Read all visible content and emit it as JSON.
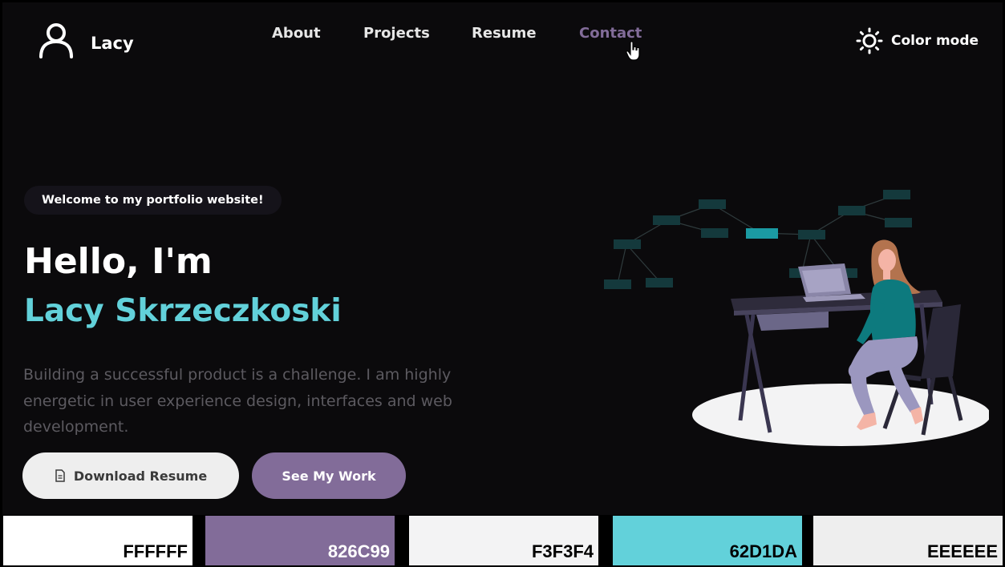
{
  "header": {
    "brand_name": "Lacy",
    "nav": {
      "about": "About",
      "projects": "Projects",
      "resume": "Resume",
      "contact": "Contact"
    },
    "color_mode_label": "Color mode"
  },
  "hero": {
    "badge": "Welcome to my portfolio website!",
    "greeting": "Hello, I'm",
    "name": "Lacy Skrzeczkoski",
    "description": "Building a successful product is a challenge. I am highly energetic in user experience design, interfaces and web development.",
    "download_button": "Download Resume",
    "work_button": "See My Work"
  },
  "palette": [
    {
      "label": "FFFFFF",
      "color": "#FFFFFF",
      "text_color": "#000000"
    },
    {
      "label": "826C99",
      "color": "#826C99",
      "text_color": "#FFFFFF"
    },
    {
      "label": "F3F3F4",
      "color": "#F3F3F4",
      "text_color": "#000000"
    },
    {
      "label": "62D1DA",
      "color": "#62D1DA",
      "text_color": "#000000"
    },
    {
      "label": "EEEEEE",
      "color": "#EEEEEE",
      "text_color": "#000000"
    }
  ],
  "icons": {
    "brand": "user-outline-icon",
    "color_mode": "sun-icon",
    "download": "document-icon",
    "cursor": "hand-pointer-icon"
  },
  "colors": {
    "background": "#0B0A0C",
    "accent_purple": "#826C99",
    "accent_teal": "#62D1DA"
  }
}
